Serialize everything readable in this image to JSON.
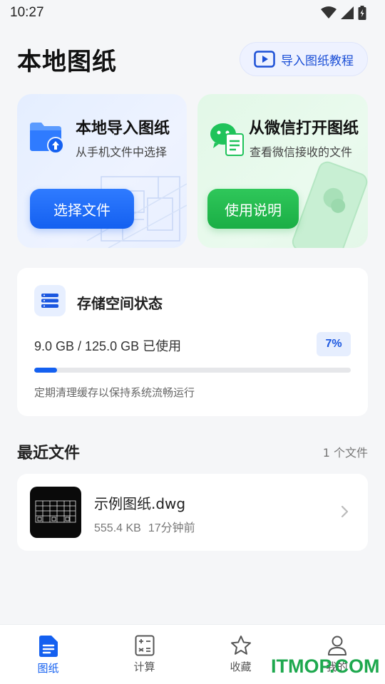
{
  "status_bar": {
    "time": "10:27"
  },
  "header": {
    "title": "本地图纸",
    "tutorial_label": "导入图纸教程"
  },
  "import_card": {
    "title": "本地导入图纸",
    "subtitle": "从手机文件中选择",
    "button_label": "选择文件"
  },
  "wechat_card": {
    "title": "从微信打开图纸",
    "subtitle": "查看微信接收的文件",
    "button_label": "使用说明"
  },
  "storage": {
    "title": "存储空间状态",
    "usage_text": "9.0 GB / 125.0 GB 已使用",
    "percent_label": "7%",
    "percent_value": 0.072,
    "tip": "定期清理缓存以保持系统流畅运行"
  },
  "recent": {
    "title": "最近文件",
    "count": "1 个文件",
    "files": [
      {
        "name": "示例图纸.dwg",
        "size": "555.4 KB",
        "time": "17分钟前"
      }
    ]
  },
  "bottom_nav": {
    "items": [
      {
        "label": "图纸",
        "icon": "document-icon",
        "active": true
      },
      {
        "label": "计算",
        "icon": "calculator-icon",
        "active": false
      },
      {
        "label": "收藏",
        "icon": "star-icon",
        "active": false
      },
      {
        "label": "我的",
        "icon": "person-icon",
        "active": false
      }
    ]
  },
  "watermark": "ITMOP.COM",
  "colors": {
    "accent_blue": "#1460f0",
    "accent_green": "#1aae45",
    "background": "#f5f6f8"
  }
}
